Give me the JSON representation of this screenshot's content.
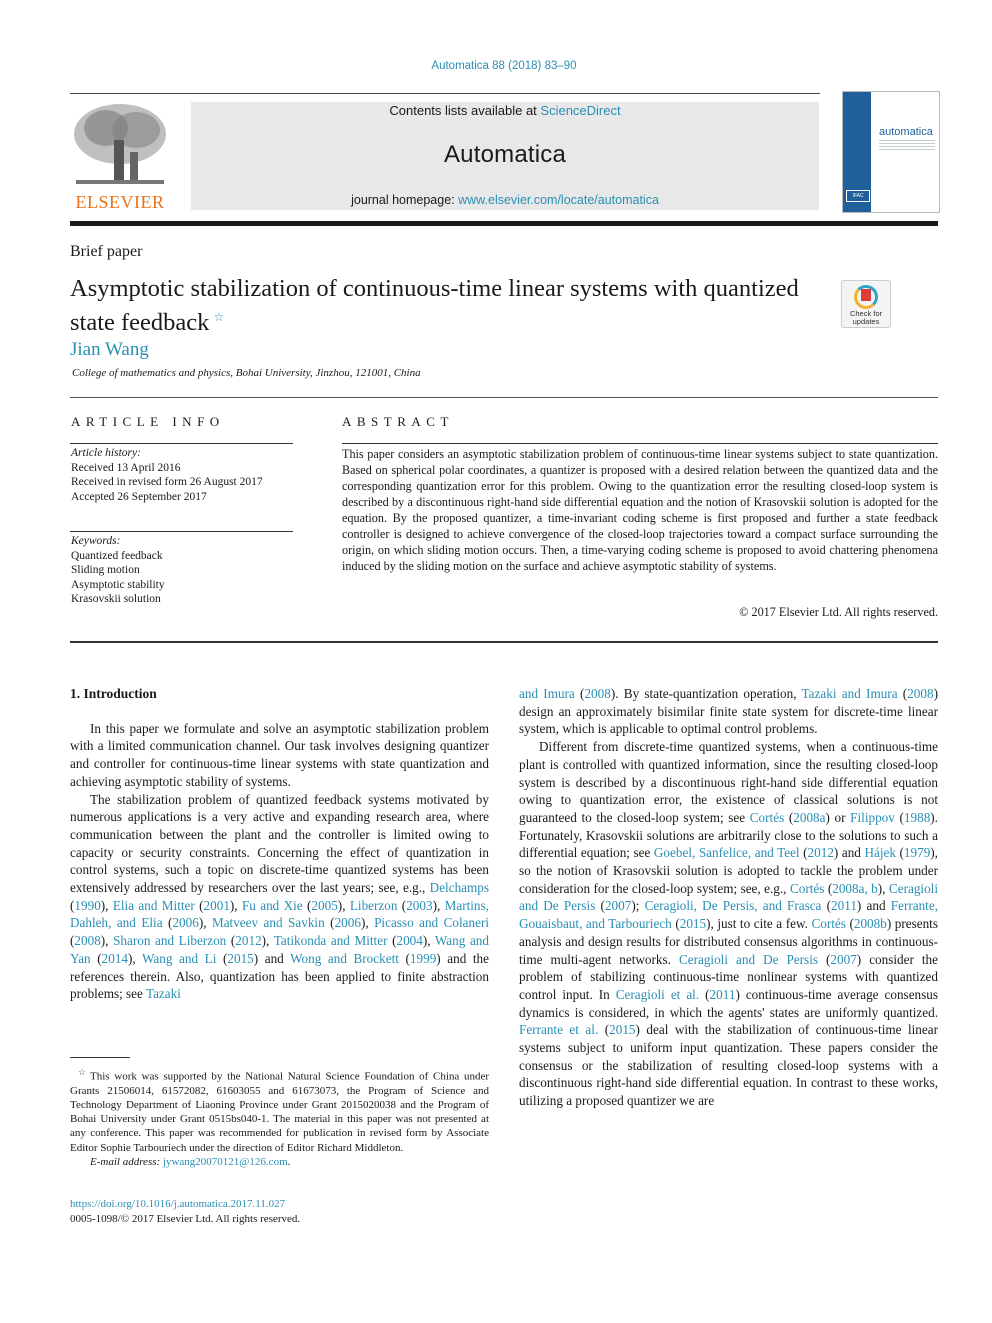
{
  "header": {
    "journal_ref": "Automatica 88 (2018) 83–90",
    "contents_prefix": "Contents lists available at ",
    "contents_link": "ScienceDirect",
    "journal_title": "Automatica",
    "homepage_prefix": "journal homepage: ",
    "homepage_link": "www.elsevier.com/locate/automatica",
    "publisher_logo_text": "ELSEVIER",
    "cover_title": "automatica",
    "cover_badge": "IFAC"
  },
  "article": {
    "type": "Brief paper",
    "title": "Asymptotic stabilization of continuous-time linear systems with quantized state feedback",
    "title_note_mark": "☆",
    "check_updates_label": "Check for updates",
    "author": "Jian Wang",
    "affiliation": "College of mathematics and physics, Bohai University, Jinzhou, 121001, China"
  },
  "article_info": {
    "heading": "ARTICLE INFO",
    "history_label": "Article history:",
    "history": [
      "Received 13 April 2016",
      "Received in revised form 26 August 2017",
      "Accepted 26 September 2017"
    ],
    "keywords_label": "Keywords:",
    "keywords": [
      "Quantized feedback",
      "Sliding motion",
      "Asymptotic stability",
      "Krasovskii solution"
    ]
  },
  "abstract": {
    "heading": "ABSTRACT",
    "text": "This paper considers an asymptotic stabilization problem of continuous-time linear systems subject to state quantization. Based on spherical polar coordinates, a quantizer is proposed with a desired relation between the quantized data and the corresponding quantization error for this problem. Owing to the quantization error the resulting closed-loop system is described by a discontinuous right-hand side differential equation and the notion of Krasovskii solution is adopted for the equation. By the proposed quantizer, a time-invariant coding scheme is first proposed and further a state feedback controller is designed to achieve convergence of the closed-loop trajectories toward a compact surface surrounding the origin, on which sliding motion occurs. Then, a time-varying coding scheme is proposed to avoid chattering phenomena induced by the sliding motion on the surface and achieve asymptotic stability of systems.",
    "copyright": "© 2017 Elsevier Ltd. All rights reserved."
  },
  "body": {
    "section_title": "1.  Introduction",
    "left_paragraphs": [
      [
        {
          "t": "In this paper we formulate and solve an asymptotic stabilization problem with a limited communication channel. Our task involves designing quantizer and controller for continuous-time linear systems with state quantization and achieving asymptotic stability of systems."
        }
      ],
      [
        {
          "t": "The stabilization problem of quantized feedback systems motivated by numerous applications is a very active and expanding research area, where communication between the plant and the controller is limited owing to capacity or security constraints. Concerning the effect of quantization in control systems, such a topic on discrete-time quantized systems has been extensively addressed by researchers over the last years; see, e.g., "
        },
        {
          "l": "Delchamps"
        },
        {
          "t": " ("
        },
        {
          "l": "1990"
        },
        {
          "t": "), "
        },
        {
          "l": "Elia and Mitter"
        },
        {
          "t": " ("
        },
        {
          "l": "2001"
        },
        {
          "t": "), "
        },
        {
          "l": "Fu and Xie"
        },
        {
          "t": " ("
        },
        {
          "l": "2005"
        },
        {
          "t": "), "
        },
        {
          "l": "Liberzon"
        },
        {
          "t": " ("
        },
        {
          "l": "2003"
        },
        {
          "t": "), "
        },
        {
          "l": "Martins, Dahleh, and Elia"
        },
        {
          "t": " ("
        },
        {
          "l": "2006"
        },
        {
          "t": "), "
        },
        {
          "l": "Matveev and Savkin"
        },
        {
          "t": " ("
        },
        {
          "l": "2006"
        },
        {
          "t": "), "
        },
        {
          "l": "Picasso and Colaneri"
        },
        {
          "t": " ("
        },
        {
          "l": "2008"
        },
        {
          "t": "), "
        },
        {
          "l": "Sharon and Liberzon"
        },
        {
          "t": " ("
        },
        {
          "l": "2012"
        },
        {
          "t": "), "
        },
        {
          "l": "Tatikonda and Mitter"
        },
        {
          "t": " ("
        },
        {
          "l": "2004"
        },
        {
          "t": "), "
        },
        {
          "l": "Wang and Yan"
        },
        {
          "t": " ("
        },
        {
          "l": "2014"
        },
        {
          "t": "), "
        },
        {
          "l": "Wang and Li"
        },
        {
          "t": " ("
        },
        {
          "l": "2015"
        },
        {
          "t": ") and "
        },
        {
          "l": "Wong and Brockett"
        },
        {
          "t": " ("
        },
        {
          "l": "1999"
        },
        {
          "t": ") and the references therein. Also, quantization has been applied to finite abstraction problems; see "
        },
        {
          "l": "Tazaki"
        }
      ]
    ],
    "right_paragraphs": [
      [
        {
          "l": "and Imura"
        },
        {
          "t": " ("
        },
        {
          "l": "2008"
        },
        {
          "t": "). By state-quantization operation, "
        },
        {
          "l": "Tazaki and Imura"
        },
        {
          "t": " ("
        },
        {
          "l": "2008"
        },
        {
          "t": ") design an approximately bisimilar finite state system for discrete-time linear system, which is applicable to optimal control problems."
        }
      ],
      [
        {
          "t": "Different from discrete-time quantized systems, when a continuous-time plant is controlled with quantized information, since the resulting closed-loop system is described by a discontinuous right-hand side differential equation owing to quantization error, the existence of classical solutions is not guaranteed to the closed-loop system; see "
        },
        {
          "l": "Cortés"
        },
        {
          "t": " ("
        },
        {
          "l": "2008a"
        },
        {
          "t": ") or "
        },
        {
          "l": "Filippov"
        },
        {
          "t": " ("
        },
        {
          "l": "1988"
        },
        {
          "t": "). Fortunately, Krasovskii solutions are arbitrarily close to the solutions to such a differential equation; see "
        },
        {
          "l": "Goebel, Sanfelice, and Teel"
        },
        {
          "t": " ("
        },
        {
          "l": "2012"
        },
        {
          "t": ") and "
        },
        {
          "l": "Hájek"
        },
        {
          "t": " ("
        },
        {
          "l": "1979"
        },
        {
          "t": "), so the notion of Krasovskii solution is adopted to tackle the problem under consideration for the closed-loop system; see, e.g., "
        },
        {
          "l": "Cortés"
        },
        {
          "t": " ("
        },
        {
          "l": "2008a, b"
        },
        {
          "t": "), "
        },
        {
          "l": "Ceragioli and De Persis"
        },
        {
          "t": " ("
        },
        {
          "l": "2007"
        },
        {
          "t": "); "
        },
        {
          "l": "Ceragioli, De Persis, and Frasca"
        },
        {
          "t": " ("
        },
        {
          "l": "2011"
        },
        {
          "t": ") and "
        },
        {
          "l": "Ferrante, Gouaisbaut, and Tarbouriech"
        },
        {
          "t": " ("
        },
        {
          "l": "2015"
        },
        {
          "t": "), just to cite a few. "
        },
        {
          "l": "Cortés"
        },
        {
          "t": " ("
        },
        {
          "l": "2008b"
        },
        {
          "t": ") presents analysis and design results for distributed consensus algorithms in continuous-time multi-agent networks. "
        },
        {
          "l": "Ceragioli and De Persis"
        },
        {
          "t": " ("
        },
        {
          "l": "2007"
        },
        {
          "t": ") consider the problem of stabilizing continuous-time nonlinear systems with quantized control input. In "
        },
        {
          "l": "Ceragioli et al."
        },
        {
          "t": " ("
        },
        {
          "l": "2011"
        },
        {
          "t": ") continuous-time average consensus dynamics is considered, in which the agents' states are uniformly quantized. "
        },
        {
          "l": "Ferrante et al."
        },
        {
          "t": " ("
        },
        {
          "l": "2015"
        },
        {
          "t": ") deal with the stabilization of continuous-time linear systems subject to uniform input quantization. These papers consider the consensus or the stabilization of resulting closed-loop systems with a discontinuous right-hand side differential equation. In contrast to these works, utilizing a proposed quantizer we are"
        }
      ]
    ]
  },
  "footnote": {
    "mark": "☆",
    "text": "This work was supported by the National Natural Science Foundation of China under Grants 21506014, 61572082, 61603055 and 61673073, the Program of Science and Technology Department of Liaoning Province under Grant 2015020038 and the Program of Bohai University under Grant 0515bs040-1. The material in this paper was not presented at any conference. This paper was recommended for publication in revised form by Associate Editor Sophie Tarbouriech under the direction of Editor Richard Middleton.",
    "email_label": "E-mail address: ",
    "email": "jywang20070121@126.com",
    "email_suffix": "."
  },
  "doi": {
    "link": "https://doi.org/10.1016/j.automatica.2017.11.027",
    "issn_line": "0005-1098/© 2017 Elsevier Ltd. All rights reserved."
  },
  "colors": {
    "link": "#2a8fb4",
    "elsevier_orange": "#e9711c",
    "cover_blue": "#1f5f9c",
    "masthead_gray": "#e8e8e8"
  }
}
